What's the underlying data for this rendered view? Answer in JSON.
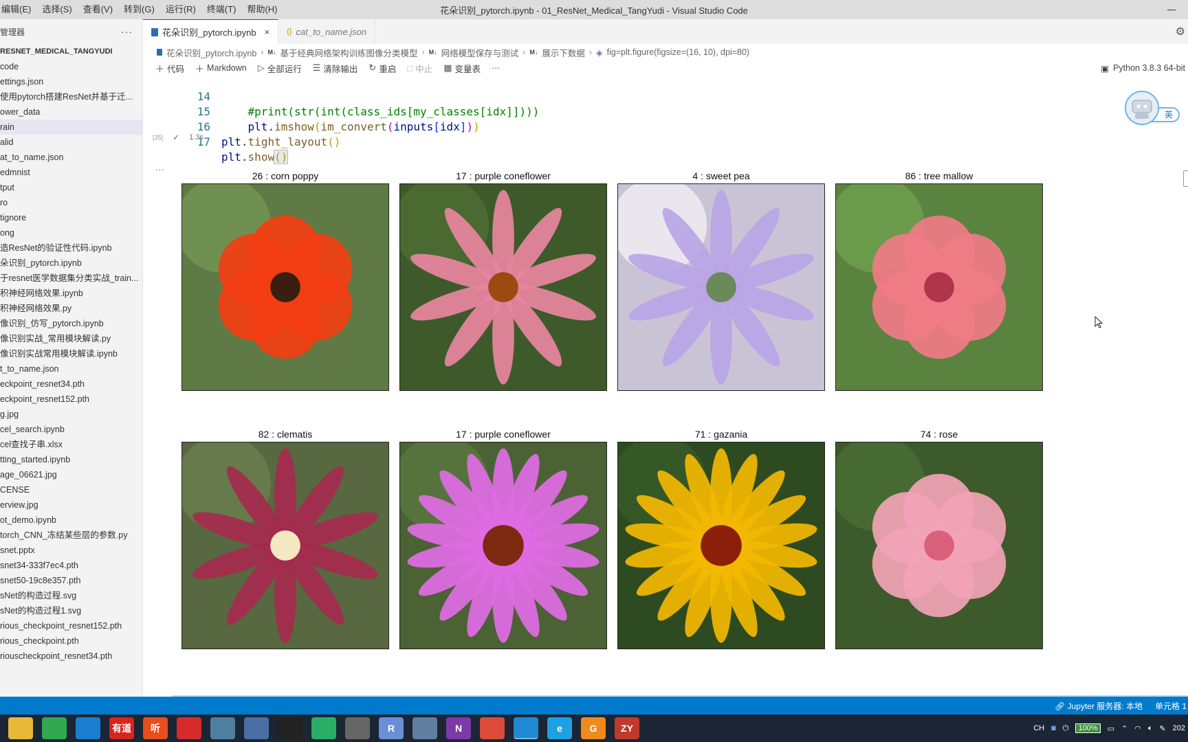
{
  "titlebar": {
    "menus": [
      "编辑(E)",
      "选择(S)",
      "查看(V)",
      "转到(G)",
      "运行(R)",
      "终端(T)",
      "帮助(H)"
    ],
    "title": "花朵识别_pytorch.ipynb - 01_ResNet_Medical_TangYudi - Visual Studio Code"
  },
  "sidebar": {
    "header": "管理器",
    "more": "···",
    "project": "RESNET_MEDICAL_TANGYUDI",
    "files": [
      "code",
      "ettings.json",
      "使用pytorch搭建ResNet并基于迁...",
      "ower_data",
      "rain",
      "alid",
      "at_to_name.json",
      "edmnist",
      "tput",
      "ro",
      "tignore",
      "ong",
      "造ResNet的验证性代码.ipynb",
      "朵识别_pytorch.ipynb",
      "于resnet医学数据集分类实战_train...",
      "积神经网络效果.ipynb",
      "积神经网络效果.py",
      "像识别_仿写_pytorch.ipynb",
      "像识别实战_常用模块解读.py",
      "像识别实战常用模块解读.ipynb",
      "t_to_name.json",
      "eckpoint_resnet34.pth",
      "eckpoint_resnet152.pth",
      "g.jpg",
      "cel_search.ipynb",
      "cel查找子串.xlsx",
      "tting_started.ipynb",
      "age_06621.jpg",
      "CENSE",
      "erview.jpg",
      "ot_demo.ipynb",
      "torch_CNN_冻结某些层的参数.py",
      "snet.pptx",
      "snet34-333f7ec4.pth",
      "snet50-19c8e357.pth",
      "sNet的构造过程.svg",
      "sNet的构造过程1.svg",
      "rious_checkpoint_resnet152.pth",
      "rious_checkpoint.pth",
      "riouscheckpoint_resnet34.pth"
    ],
    "selected_index": 4
  },
  "tabs": [
    {
      "label": "花朵识别_pytorch.ipynb",
      "close": "×"
    },
    {
      "label": "cat_to_name.json",
      "icon": "{}"
    }
  ],
  "breadcrumb": {
    "items": [
      "花朵识别_pytorch.ipynb",
      "基于经典网络架构训练图像分类模型",
      "网络模型保存与测试",
      "展示下数据",
      "fig=plt.figure(figsize=(16, 10), dpi=80)"
    ],
    "md_badge": "M↓",
    "sep": "›"
  },
  "toolbar": {
    "code": "代码",
    "markdown": "Markdown",
    "run_all": "全部运行",
    "clear_output": "清除输出",
    "restart": "重启",
    "interrupt": "中止",
    "variables": "变量表",
    "more": "···",
    "kernel": "Python 3.8.3 64-bit"
  },
  "code": {
    "lines": [
      {
        "no": "14",
        "indent": "    ",
        "comment": "#print(str(int(class_ids[my_classes[idx]])))"
      },
      {
        "no": "15",
        "indent": "    "
      },
      {
        "no": "16"
      },
      {
        "no": "17"
      }
    ],
    "exec_count": "[35]",
    "exec_time": "1.3s",
    "output_ellipsis": "..."
  },
  "flowers": [
    {
      "title": "26 : corn poppy",
      "palette": [
        "#5f7a45",
        "#f33e12",
        "#3a1e10"
      ]
    },
    {
      "title": "17 : purple coneflower",
      "palette": [
        "#3f5a2a",
        "#e8869f",
        "#9b4a12"
      ]
    },
    {
      "title": "4 : sweet pea",
      "palette": [
        "#c9c3d6",
        "#b8a5e6",
        "#6a8a5a"
      ]
    },
    {
      "title": "86 : tree mallow",
      "palette": [
        "#5b8340",
        "#f07b86",
        "#b0344a"
      ]
    },
    {
      "title": "82 : clematis",
      "palette": [
        "#586840",
        "#a52a4e",
        "#f4e9c2"
      ]
    },
    {
      "title": "17 : purple coneflower",
      "palette": [
        "#4a6234",
        "#e06be4",
        "#7c2a10"
      ]
    },
    {
      "title": "71 : gazania",
      "palette": [
        "#2e4a20",
        "#f3b700",
        "#8c1f0a"
      ]
    },
    {
      "title": "74 : rose",
      "palette": [
        "#3d5a2c",
        "#f2a3b6",
        "#d9607b"
      ]
    }
  ],
  "overlay": {
    "ime_label": "英"
  },
  "statusbar": {
    "jupyter": "Jupyter 服务器: 本地",
    "cell": "单元格 1"
  },
  "taskbar": {
    "apps": [
      {
        "name": "file-explorer",
        "label": "",
        "color": "#e8b838"
      },
      {
        "name": "360-browser",
        "label": "",
        "color": "#2fa84f"
      },
      {
        "name": "edge",
        "label": "",
        "color": "#1b7fd1"
      },
      {
        "name": "youdao",
        "label": "有道",
        "color": "#d7241d"
      },
      {
        "name": "listen",
        "label": "听",
        "color": "#e84d1d"
      },
      {
        "name": "netease-music",
        "label": "",
        "color": "#d72b2b"
      },
      {
        "name": "parrot",
        "label": "",
        "color": "#4f7f9f"
      },
      {
        "name": "calculator",
        "label": "",
        "color": "#4a6fa5"
      },
      {
        "name": "qq",
        "label": "",
        "color": "#222"
      },
      {
        "name": "wechat",
        "label": "",
        "color": "#2aae67"
      },
      {
        "name": "usb-tool",
        "label": "",
        "color": "#666"
      },
      {
        "name": "r-app",
        "label": "R",
        "color": "#6a8fd8"
      },
      {
        "name": "camera-app",
        "label": "",
        "color": "#5f7fa0"
      },
      {
        "name": "onenote",
        "label": "N",
        "color": "#7b3aa8"
      },
      {
        "name": "chrome",
        "label": "",
        "color": "#dd4b39"
      },
      {
        "name": "vscode",
        "label": "",
        "color": "#1f8ad2"
      },
      {
        "name": "ie-edge",
        "label": "e",
        "color": "#1da1e2"
      },
      {
        "name": "orange-app",
        "label": "G",
        "color": "#f08a1c"
      },
      {
        "name": "zy-app",
        "label": "ZY",
        "color": "#c0392b"
      }
    ],
    "tray": {
      "lang": "CH",
      "battery": "100%",
      "year": "202"
    }
  }
}
